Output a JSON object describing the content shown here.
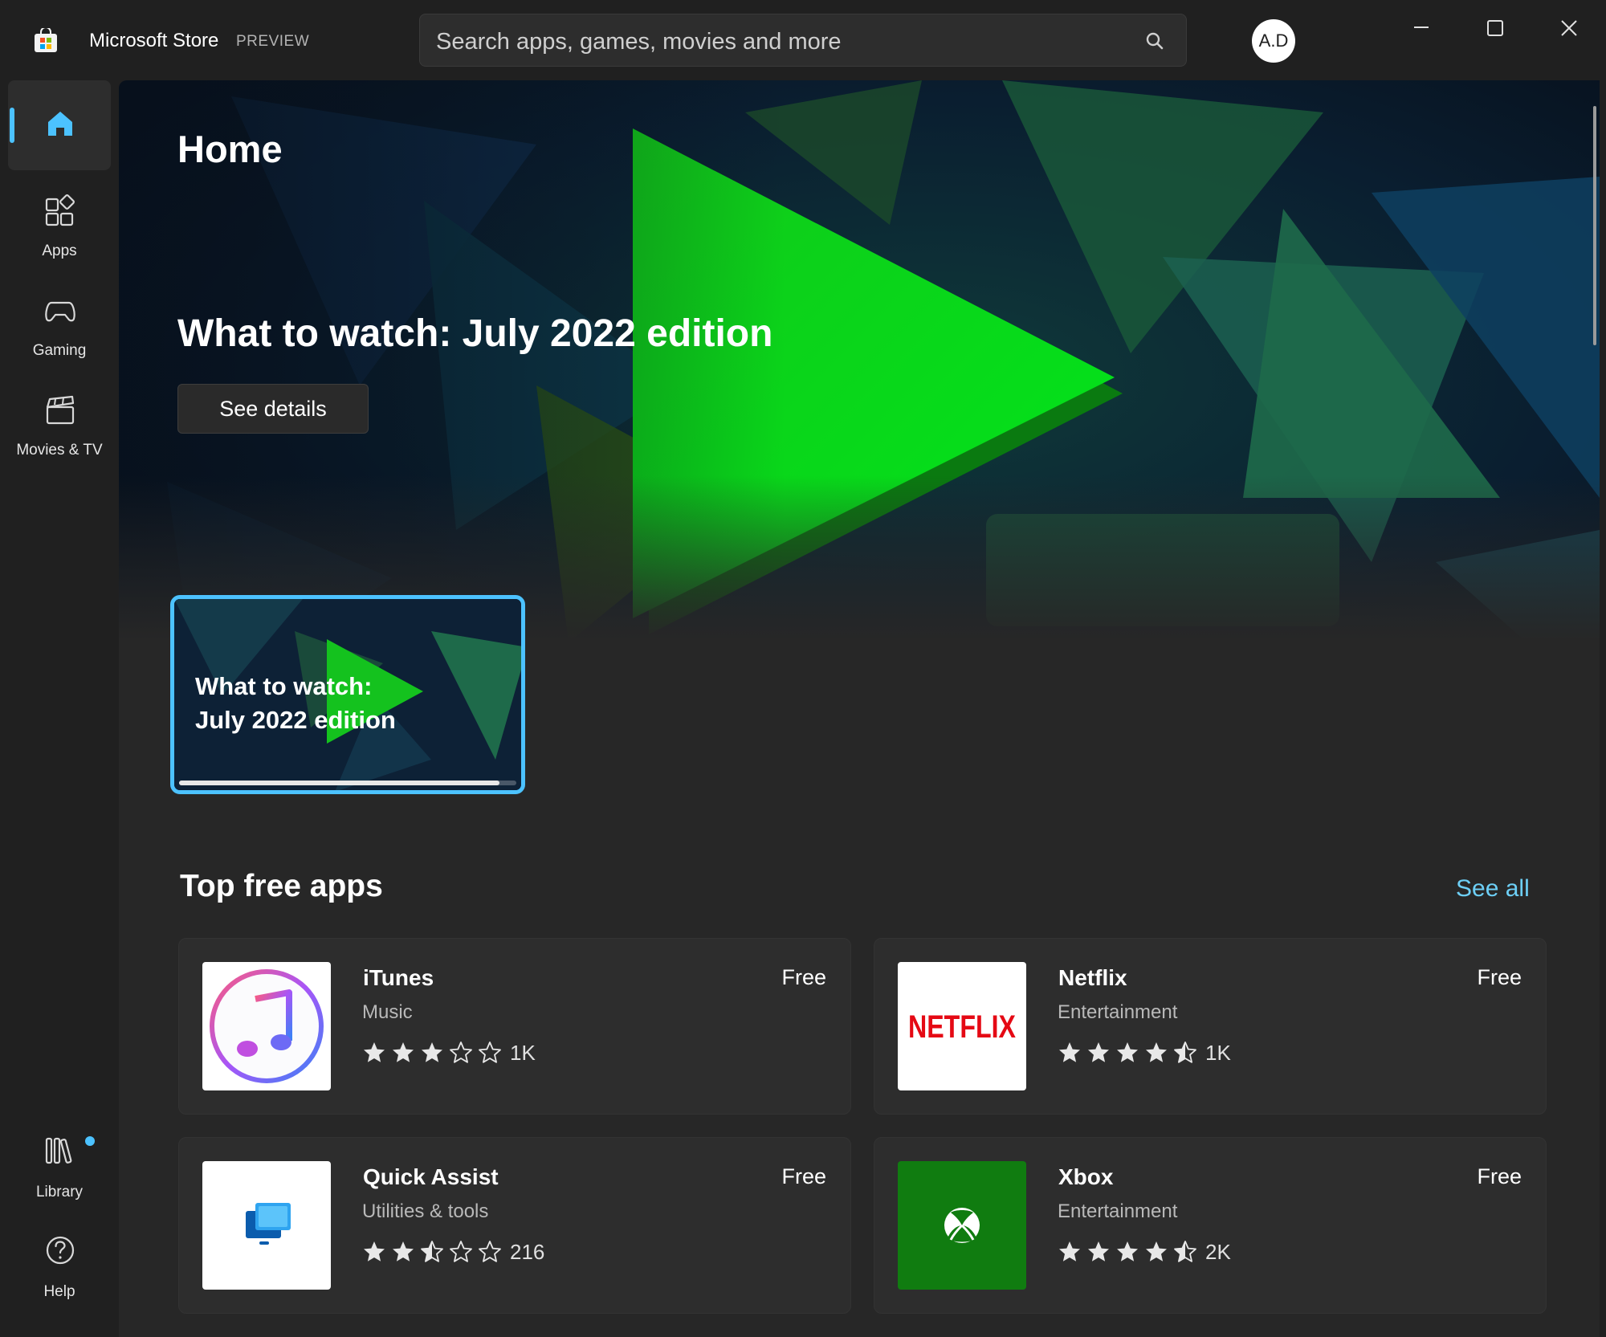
{
  "window": {
    "app_title": "Microsoft Store",
    "app_badge": "PREVIEW",
    "search_placeholder": "Search apps, games, movies and more",
    "user_initials": "A.D"
  },
  "sidebar": {
    "items": [
      {
        "label": "",
        "icon": "home-icon",
        "active": true
      },
      {
        "label": "Apps",
        "icon": "apps-icon"
      },
      {
        "label": "Gaming",
        "icon": "gamepad-icon"
      },
      {
        "label": "Movies & TV",
        "icon": "clapperboard-icon"
      }
    ],
    "bottom": [
      {
        "label": "Library",
        "icon": "library-icon",
        "notification": true
      },
      {
        "label": "Help",
        "icon": "help-icon"
      }
    ]
  },
  "main": {
    "page_title": "Home",
    "hero": {
      "title": "What to watch: July 2022 edition",
      "button_label": "See details",
      "card_title_line1": "What to watch:",
      "card_title_line2": "July 2022 edition",
      "card_progress": 0.95
    },
    "section": {
      "title": "Top free apps",
      "see_all": "See all"
    },
    "apps": [
      {
        "name": "iTunes",
        "category": "Music",
        "price": "Free",
        "rating": 3,
        "count": "1K",
        "icon": "itunes-icon"
      },
      {
        "name": "Netflix",
        "category": "Entertainment",
        "price": "Free",
        "rating": 4.5,
        "count": "1K",
        "icon": "netflix-icon",
        "logo_text": "NETFLIX"
      },
      {
        "name": "Quick Assist",
        "category": "Utilities & tools",
        "price": "Free",
        "rating": 2.5,
        "count": "216",
        "icon": "quick-assist-icon"
      },
      {
        "name": "Xbox",
        "category": "Entertainment",
        "price": "Free",
        "rating": 4.5,
        "count": "2K",
        "icon": "xbox-icon"
      }
    ]
  },
  "colors": {
    "accent": "#4cc2ff",
    "link": "#6dcff6",
    "netflix_red": "#e50914",
    "xbox_green": "#107c10"
  }
}
